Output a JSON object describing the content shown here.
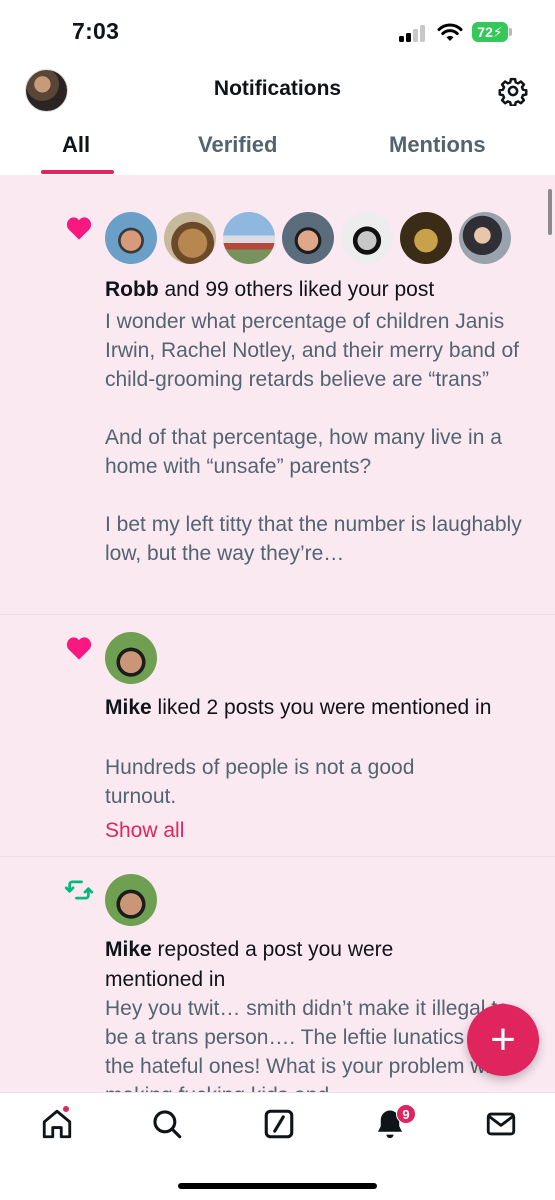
{
  "status_bar": {
    "time": "7:03",
    "battery": "72"
  },
  "header": {
    "title": "Notifications"
  },
  "tabs": [
    {
      "label": "All",
      "active": true
    },
    {
      "label": "Verified",
      "active": false
    },
    {
      "label": "Mentions",
      "active": false
    }
  ],
  "notifications": [
    {
      "type": "like",
      "icon": "heart-icon",
      "avatar_count": 7,
      "actor": "Robb",
      "action": " and 99 others liked your post",
      "body": "I wonder what percentage of children Janis Irwin, Rachel Notley, and their merry band of child-grooming retards believe are “trans”\n\nAnd of that percentage, how many live in a home with “unsafe” parents?\n\nI bet my left titty that the number is laughably low, but the way they’re…"
    },
    {
      "type": "like",
      "icon": "heart-icon",
      "avatar_count": 1,
      "actor": "Mike",
      "action": " liked 2 posts you were mentioned in",
      "body": "Hundreds of people is not a good turnout.",
      "link": "Show all"
    },
    {
      "type": "repost",
      "icon": "repost-icon",
      "avatar_count": 1,
      "actor": "Mike",
      "action": " reposted a post you were mentioned in",
      "body": "Hey you twit… smith didn’t make it illegal to be a trans person…. The leftie lunatics are the hateful ones! What is your problem with making fucking kids and"
    }
  ],
  "fab": {
    "label": "+"
  },
  "bottom_nav": {
    "items": [
      "home",
      "search",
      "grok",
      "notifications",
      "messages"
    ],
    "notification_badge": "9"
  },
  "colors": {
    "accent": "#e0245e",
    "feed_background": "#fbe9f2",
    "repost_green": "#00ba7c"
  }
}
